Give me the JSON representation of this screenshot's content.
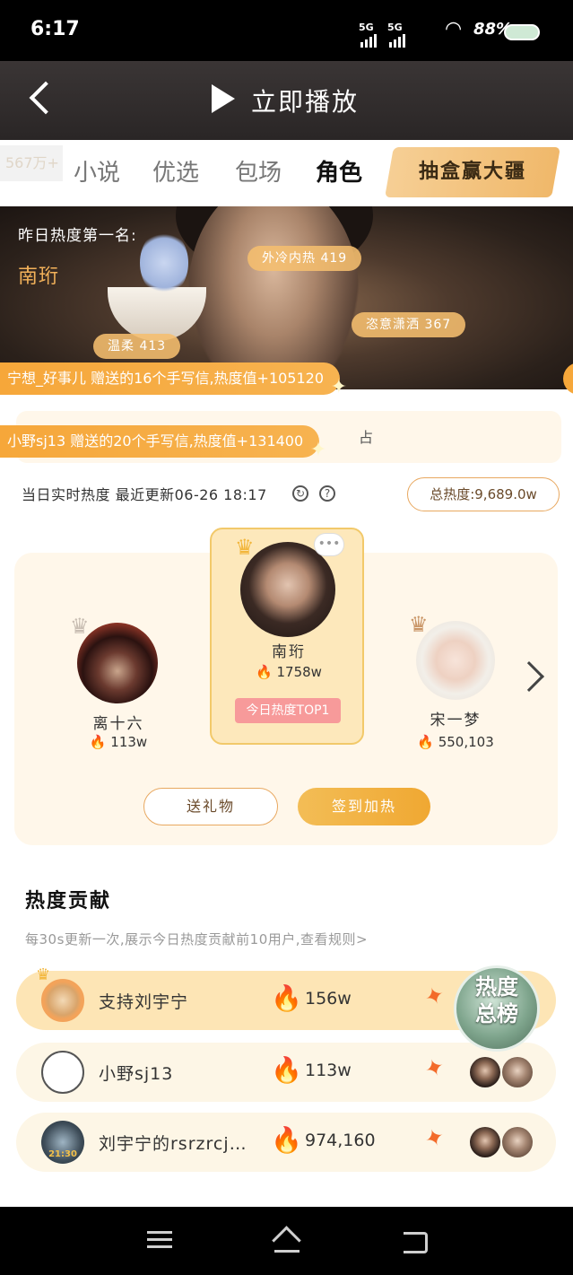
{
  "status_bar": {
    "time": "6:17",
    "network_1": "5G",
    "network_2": "5G",
    "battery": "88%"
  },
  "header": {
    "play_label": "立即播放"
  },
  "tabs": {
    "count_badge": "567万+",
    "items": [
      {
        "label": "小说",
        "active": false
      },
      {
        "label": "优选",
        "active": false
      },
      {
        "label": "包场",
        "active": false
      },
      {
        "label": "角色",
        "active": true
      }
    ],
    "promo_label": "抽盒赢大疆"
  },
  "banner": {
    "rank_title": "昨日热度第一名:",
    "rank_name": "南珩",
    "tags": [
      {
        "label": "外冷内热 419"
      },
      {
        "label": "恣意潇洒 367"
      },
      {
        "label": "温柔 413"
      }
    ]
  },
  "tickers": [
    {
      "text": "宁想_好事儿 赠送的16个手写信,热度值+105120"
    },
    {
      "text": "小野sj13 赠送的20个手写信,热度值+131400"
    }
  ],
  "search_row": {
    "tail_text": "占"
  },
  "heat": {
    "update_text": "当日实时热度 最近更新06-26 18:17",
    "refresh_icon": "refresh-icon",
    "help_icon": "?",
    "total_label": "总热度:9,689.0w"
  },
  "podium": {
    "first": {
      "name": "南珩",
      "heat": "1758w",
      "badge": "今日热度TOP1"
    },
    "second": {
      "name": "离十六",
      "heat": "113w"
    },
    "third": {
      "name": "宋一梦",
      "heat": "550,103"
    },
    "gift_button": "送礼物",
    "sign_button": "签到加热",
    "bubble": "•••"
  },
  "contrib": {
    "title": "热度贡献",
    "subtitle": "每30s更新一次,展示今日热度贡献前10用户,查看规则>",
    "rows": [
      {
        "name": "支持刘宇宁",
        "heat": "156w"
      },
      {
        "name": "小野sj13",
        "heat": "113w"
      },
      {
        "name": "刘宇宁的rsrzrcj…",
        "heat": "974,160"
      }
    ],
    "float_label_1": "热度",
    "float_label_2": "总榜",
    "avatar_time": "21:30"
  },
  "colors": {
    "accent": "#f0a832",
    "card": "#fff7ea",
    "flame": "#f36b2a"
  }
}
